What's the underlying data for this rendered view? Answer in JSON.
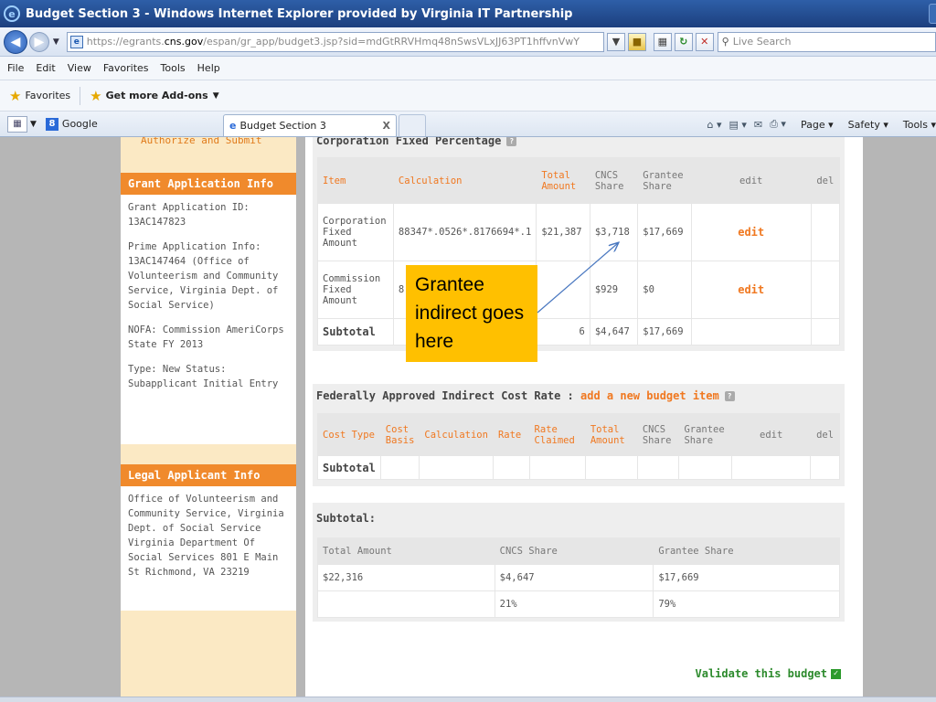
{
  "window": {
    "title": "Budget Section 3 - Windows Internet Explorer provided by Virginia IT Partnership"
  },
  "addressbar": {
    "url_scheme_host": "https://egrants.",
    "url_domain": "cns.gov",
    "url_path": "/espan/gr_app/budget3.jsp?sid=mdGtRRVHmq48nSwsVLxJJ63PT1hffvnVwY",
    "search_placeholder": "Live Search"
  },
  "menu": [
    "File",
    "Edit",
    "View",
    "Favorites",
    "Tools",
    "Help"
  ],
  "favorites_bar": {
    "favorites_label": "Favorites",
    "addons_label": "Get more Add-ons"
  },
  "tabs": {
    "google_label": "Google",
    "active_label": "Budget Section 3",
    "close_glyph": "X"
  },
  "command_bar": {
    "page_label": "Page",
    "safety_label": "Safety",
    "tools_label": "Tools"
  },
  "sidebar": {
    "cut_link": "Authorize and Submit",
    "grant_head": "Grant Application Info",
    "grant_id": "Grant Application ID: 13AC147823",
    "prime_info": "Prime Application Info: 13AC147464 (Office of Volunteerism and Community Service, Virginia Dept. of Social Service)",
    "nofa": "NOFA: Commission AmeriCorps State FY 2013",
    "type_status": "Type: New Status: Subapplicant Initial Entry",
    "legal_head": "Legal Applicant Info",
    "legal_info": "Office of Volunteerism and Community Service, Virginia Dept. of Social Service Virginia Department Of Social Services 801 E Main St Richmond, VA 23219"
  },
  "corp": {
    "heading": "Corporation Fixed Percentage",
    "headers": [
      "Item",
      "Calculation",
      "Total Amount",
      "CNCS Share",
      "Grantee Share",
      "edit",
      "del"
    ],
    "rows": [
      {
        "item": "Corporation Fixed Amount",
        "calc": "88347*.0526*.8176694*.1",
        "total": "$21,387",
        "cncs": "$3,718",
        "grantee": "$17,669",
        "edit": "edit"
      },
      {
        "item": "Commission Fixed Amount",
        "calc": "8",
        "total": "",
        "cncs": "$929",
        "grantee": "$0",
        "edit": "edit"
      }
    ],
    "subtotal": {
      "label": "Subtotal",
      "total": "6",
      "cncs": "$4,647",
      "grantee": "$17,669"
    }
  },
  "callout": {
    "text": "Grantee indirect goes here"
  },
  "indirect": {
    "heading": "Federally Approved Indirect Cost Rate :",
    "add_link": "add a new budget item",
    "headers": [
      "Cost Type",
      "Cost Basis",
      "Calculation",
      "Rate",
      "Rate Claimed",
      "Total Amount",
      "CNCS Share",
      "Grantee Share",
      "edit",
      "del"
    ],
    "subtotal_label": "Subtotal"
  },
  "summary": {
    "heading": "Subtotal:",
    "headers": [
      "Total Amount",
      "CNCS Share",
      "Grantee Share"
    ],
    "amounts": [
      "$22,316",
      "$4,647",
      "$17,669"
    ],
    "percents": [
      "",
      "21%",
      "79%"
    ]
  },
  "validate_label": "Validate this budget"
}
